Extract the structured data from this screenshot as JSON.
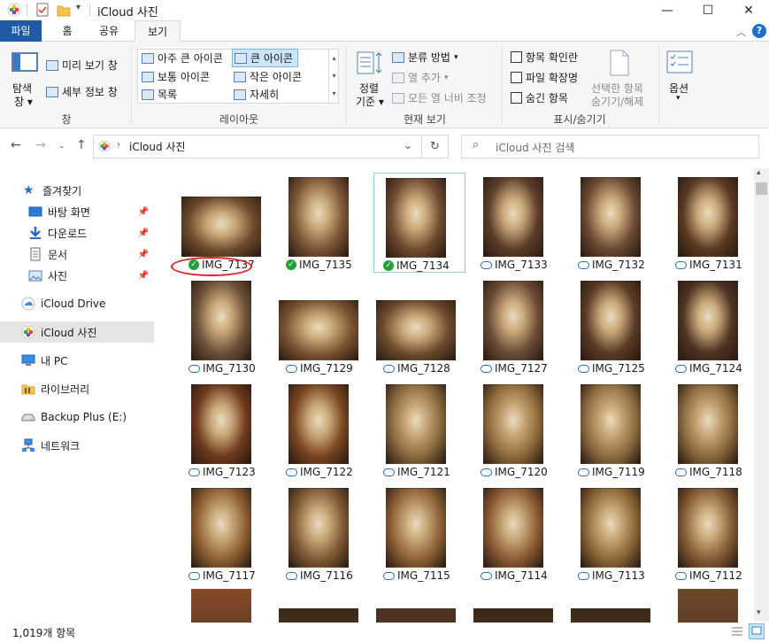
{
  "window": {
    "title": "iCloud 사진",
    "minimize": "—",
    "maximize": "☐",
    "close": "✕"
  },
  "ribbon_tabs": [
    "파일",
    "홈",
    "공유",
    "보기"
  ],
  "ribbon": {
    "pane_group": {
      "nav_pane": "탐색",
      "nav_pane2": "창",
      "preview": "미리 보기 창",
      "details": "세부 정보 창",
      "label": "창"
    },
    "layout_group": {
      "items": [
        "아주 큰 아이콘",
        "큰 아이콘",
        "보통 아이콘",
        "작은 아이콘",
        "목록",
        "자세히"
      ],
      "selected": "큰 아이콘",
      "label": "레이아웃"
    },
    "current_view": {
      "sort": "정렬",
      "sort2": "기준",
      "group_by": "분류 방법",
      "add_columns": "열 추가",
      "fit_columns": "모든 열 너비 조정",
      "label": "현재 보기"
    },
    "show_hide": {
      "item_checkbox": "항목 확인란",
      "file_ext": "파일 확장명",
      "hidden_items": "숨긴 항목",
      "hide_selected": "선택한 항목",
      "hide_selected2": "숨기기/해제",
      "label": "표시/숨기기"
    },
    "options": "옵션"
  },
  "address": {
    "path": "iCloud 사진",
    "search_placeholder": "iCloud 사진 검색"
  },
  "nav": {
    "quick_access": "즐겨찾기",
    "items": [
      {
        "label": "바탕 화면",
        "pinned": true
      },
      {
        "label": "다운로드",
        "pinned": true
      },
      {
        "label": "문서",
        "pinned": true
      },
      {
        "label": "사진",
        "pinned": true
      }
    ],
    "icloud_drive": "iCloud Drive",
    "icloud_photos": "iCloud 사진",
    "this_pc": "내 PC",
    "libraries": "라이브러리",
    "backup": "Backup Plus (E:)",
    "network": "네트워크"
  },
  "files": [
    {
      "name": "IMG_7137",
      "status": "synced",
      "tone": "#6b4a2a",
      "orient": "landscape"
    },
    {
      "name": "IMG_7135",
      "status": "synced",
      "tone": "#7a5536",
      "orient": "portrait"
    },
    {
      "name": "IMG_7134",
      "status": "synced",
      "tone": "#6e4b30",
      "orient": "portrait"
    },
    {
      "name": "IMG_7133",
      "status": "cloud",
      "tone": "#5c3e2a",
      "orient": "portrait"
    },
    {
      "name": "IMG_7132",
      "status": "cloud",
      "tone": "#6a4a34",
      "orient": "portrait"
    },
    {
      "name": "IMG_7131",
      "status": "cloud",
      "tone": "#5a3a22",
      "orient": "portrait"
    },
    {
      "name": "IMG_7130",
      "status": "cloud",
      "tone": "#6d5139",
      "orient": "portrait"
    },
    {
      "name": "IMG_7129",
      "status": "cloud",
      "tone": "#7b5432",
      "orient": "landscape"
    },
    {
      "name": "IMG_7128",
      "status": "cloud",
      "tone": "#6c4a2c",
      "orient": "landscape"
    },
    {
      "name": "IMG_7127",
      "status": "cloud",
      "tone": "#6b4d37",
      "orient": "portrait"
    },
    {
      "name": "IMG_7125",
      "status": "cloud",
      "tone": "#5a3b27",
      "orient": "portrait"
    },
    {
      "name": "IMG_7124",
      "status": "cloud",
      "tone": "#4e3423",
      "orient": "portrait"
    },
    {
      "name": "IMG_7123",
      "status": "cloud",
      "tone": "#6e3a1d",
      "orient": "portrait"
    },
    {
      "name": "IMG_7122",
      "status": "cloud",
      "tone": "#7a4522",
      "orient": "portrait"
    },
    {
      "name": "IMG_7121",
      "status": "cloud",
      "tone": "#8a6a3f",
      "orient": "portrait"
    },
    {
      "name": "IMG_7120",
      "status": "cloud",
      "tone": "#8f6a3c",
      "orient": "portrait"
    },
    {
      "name": "IMG_7119",
      "status": "cloud",
      "tone": "#8e6d42",
      "orient": "portrait"
    },
    {
      "name": "IMG_7118",
      "status": "cloud",
      "tone": "#8b6a40",
      "orient": "portrait"
    },
    {
      "name": "IMG_7117",
      "status": "cloud",
      "tone": "#8c5f33",
      "orient": "portrait"
    },
    {
      "name": "IMG_7116",
      "status": "cloud",
      "tone": "#7f5936",
      "orient": "portrait"
    },
    {
      "name": "IMG_7115",
      "status": "cloud",
      "tone": "#8d6036",
      "orient": "portrait"
    },
    {
      "name": "IMG_7114",
      "status": "cloud",
      "tone": "#8a5a34",
      "orient": "portrait"
    },
    {
      "name": "IMG_7113",
      "status": "cloud",
      "tone": "#8b6738",
      "orient": "portrait"
    },
    {
      "name": "IMG_7112",
      "status": "cloud",
      "tone": "#835a34",
      "orient": "portrait"
    }
  ],
  "partial_row_tones": [
    "#8a4a2a",
    "#3b2a1a",
    "#4a3220",
    "#3a2718",
    "#3a2a1a",
    "#6b4a2a"
  ],
  "status": {
    "count": "1,019개 항목"
  },
  "colors": {
    "file_tab": "#1e5aa6",
    "selection_outline": "#9ec7ec",
    "highlight_ring": "#e02020",
    "synced": "#22a03a",
    "cloud": "#2b6cc4"
  }
}
